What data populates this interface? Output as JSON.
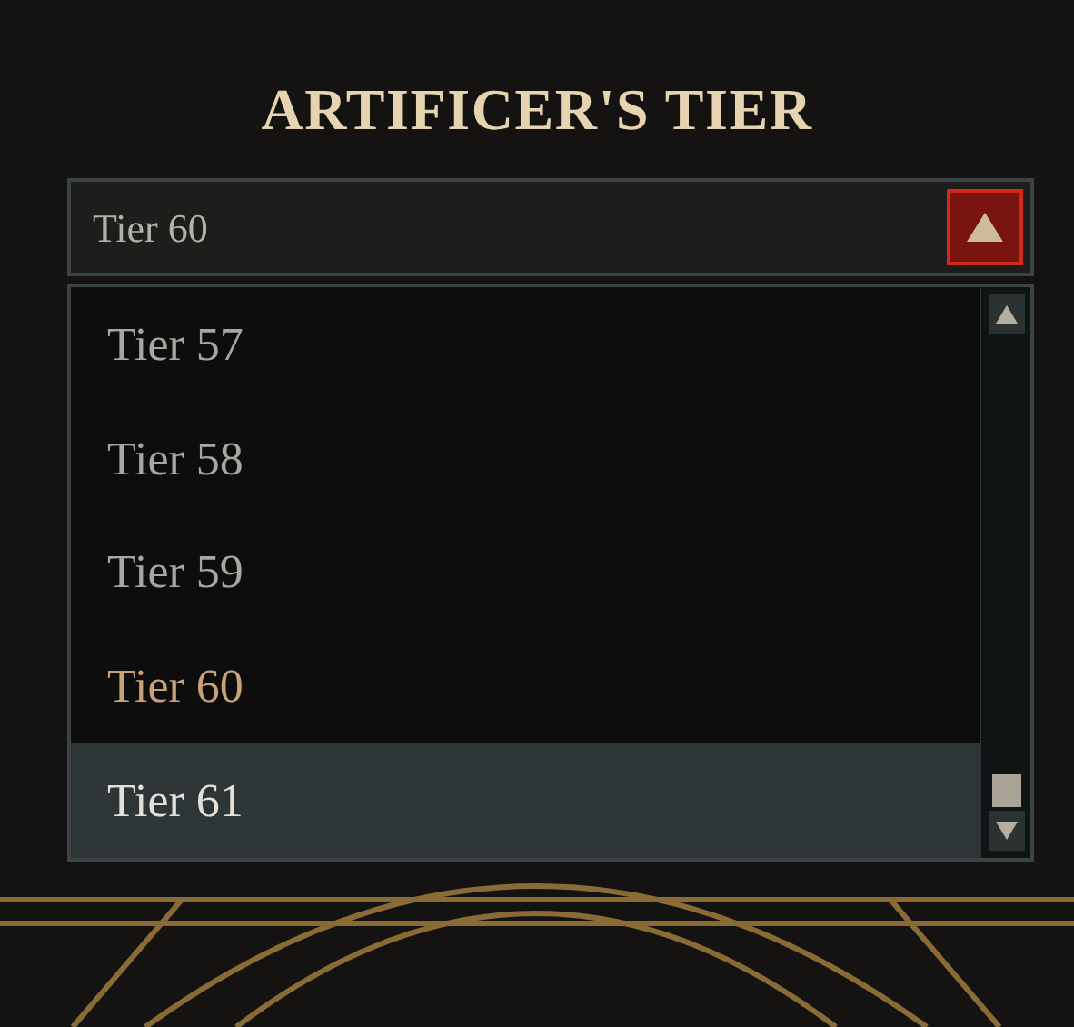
{
  "title": "ARTIFICER'S TIER",
  "dropdown": {
    "value": "Tier 60",
    "expanded": true
  },
  "options": [
    {
      "label": "Tier 57",
      "selected": false,
      "hovered": false
    },
    {
      "label": "Tier 58",
      "selected": false,
      "hovered": false
    },
    {
      "label": "Tier 59",
      "selected": false,
      "hovered": false
    },
    {
      "label": "Tier 60",
      "selected": true,
      "hovered": false
    },
    {
      "label": "Tier 61",
      "selected": false,
      "hovered": true
    }
  ]
}
